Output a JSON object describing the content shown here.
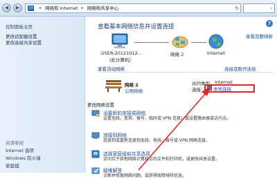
{
  "address": {
    "crumbs": [
      "网络和 Internet",
      "网络和共享中心"
    ],
    "search_hint": "⌕"
  },
  "sidebar": {
    "title": "控制面板主页",
    "links": [
      "更改适配器设置",
      "更改高级共享设置"
    ],
    "see_also_title": "另请参阅",
    "see_also": [
      "Internet 选项",
      "Windows 防火墙",
      "家庭组"
    ]
  },
  "main": {
    "headline": "查看基本网络信息并设置连接",
    "full_map_link": "查看完整映射",
    "topology": {
      "computer": "USER-20121012...",
      "computer_sub": "(此计算机)",
      "network": "网络  2",
      "internet": "Internet"
    },
    "active_title": "查看活动网络",
    "connect_link": "连接或断开连接",
    "active_network": {
      "name": "网络  2",
      "type": "公用网络",
      "access_label": "访问类型:",
      "access_value": "Internet",
      "conn_label": "连接:",
      "conn_value": "本地连接"
    },
    "change_title": "更改网络设置",
    "tasks": [
      {
        "title": "设置新的连接或网络",
        "desc": [
          "设置无线、宽带、拨号、临时或 VPN 连接；或设置路由器或访问点。"
        ]
      },
      {
        "title": "连接到网络",
        "desc": [
          "连接到或重新连接到无线、有线、拨号或 VPN 网络连接。"
        ]
      },
      {
        "title": "选择家庭组和共享选项",
        "desc": [
          "访问位于其他网络计算机上的文件和打印机，或更改共享设置。"
        ]
      },
      {
        "title": "疑难解答",
        "desc": [
          "诊断并修复网络问题，或获得故障排除信息。"
        ]
      }
    ]
  },
  "colors": {
    "highlight": "#e02626",
    "link": "#1e4fa0",
    "heading": "#1e3e77"
  }
}
